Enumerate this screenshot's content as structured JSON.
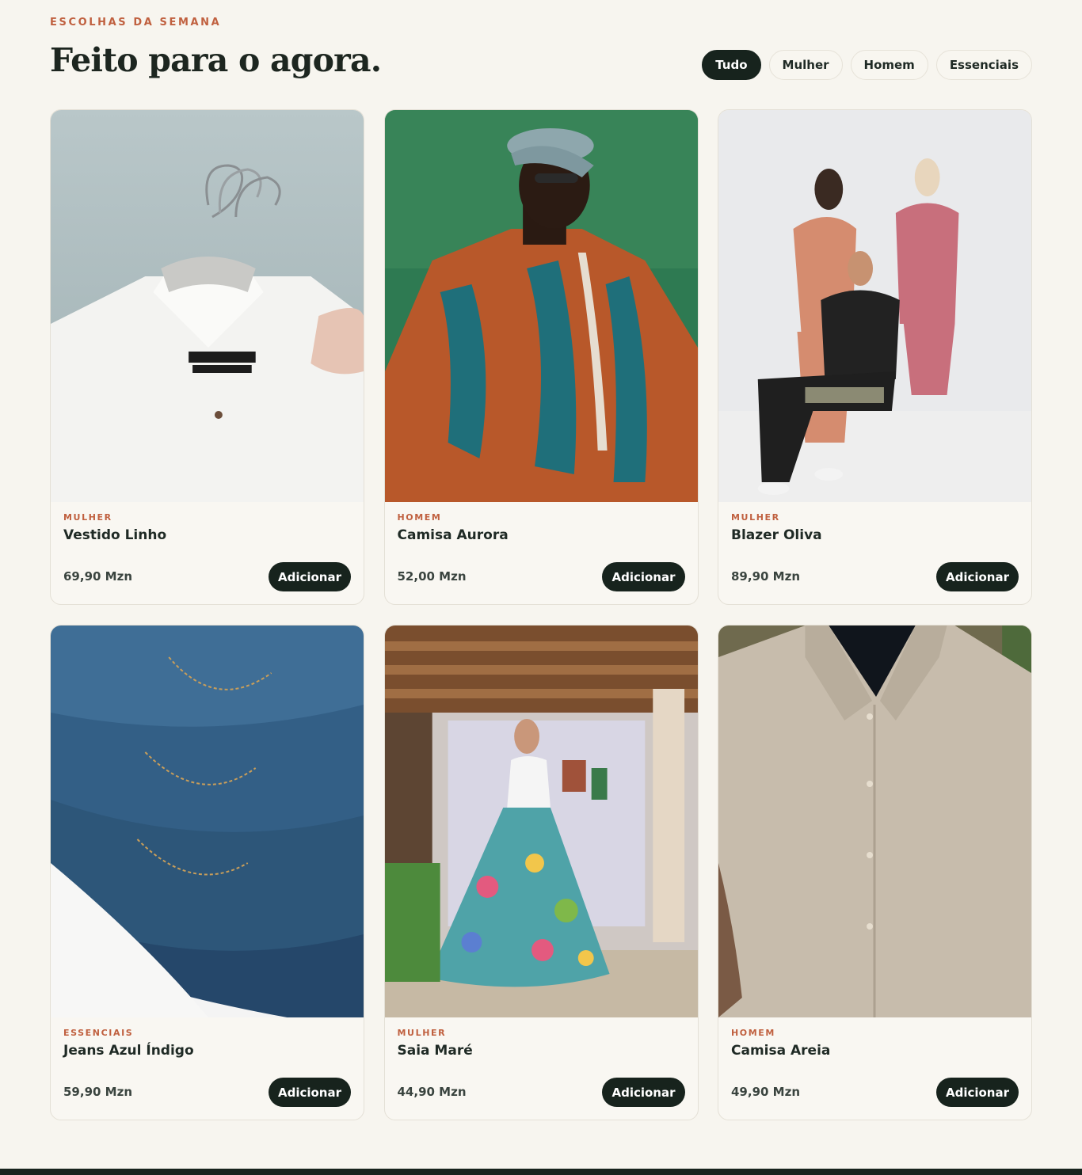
{
  "section": {
    "eyebrow": "ESCOLHAS DA SEMANA",
    "title": "Feito para o agora."
  },
  "filters": [
    {
      "label": "Tudo",
      "active": true
    },
    {
      "label": "Mulher",
      "active": false
    },
    {
      "label": "Homem",
      "active": false
    },
    {
      "label": "Essenciais",
      "active": false
    }
  ],
  "products": [
    {
      "category": "MULHER",
      "name": "Vestido Linho",
      "price": "69,90 Mzn",
      "button": "Adicionar",
      "image": "white-linen-shirt-on-hanger"
    },
    {
      "category": "HOMEM",
      "name": "Camisa Aurora",
      "price": "52,00 Mzn",
      "button": "Adicionar",
      "image": "man-in-printed-shirt-and-cap"
    },
    {
      "category": "MULHER",
      "name": "Blazer Oliva",
      "price": "89,90 Mzn",
      "button": "Adicionar",
      "image": "three-women-in-suits"
    },
    {
      "category": "ESSENCIAIS",
      "name": "Jeans Azul Índigo",
      "price": "59,90 Mzn",
      "button": "Adicionar",
      "image": "folded-blue-jeans"
    },
    {
      "category": "MULHER",
      "name": "Saia Maré",
      "price": "44,90 Mzn",
      "button": "Adicionar",
      "image": "woman-in-floral-skirt"
    },
    {
      "category": "HOMEM",
      "name": "Camisa Areia",
      "price": "49,90 Mzn",
      "button": "Adicionar",
      "image": "beige-linen-shirt"
    }
  ],
  "colors": {
    "background": "#f7f5ef",
    "accent": "#c0603f",
    "dark": "#17231d"
  }
}
